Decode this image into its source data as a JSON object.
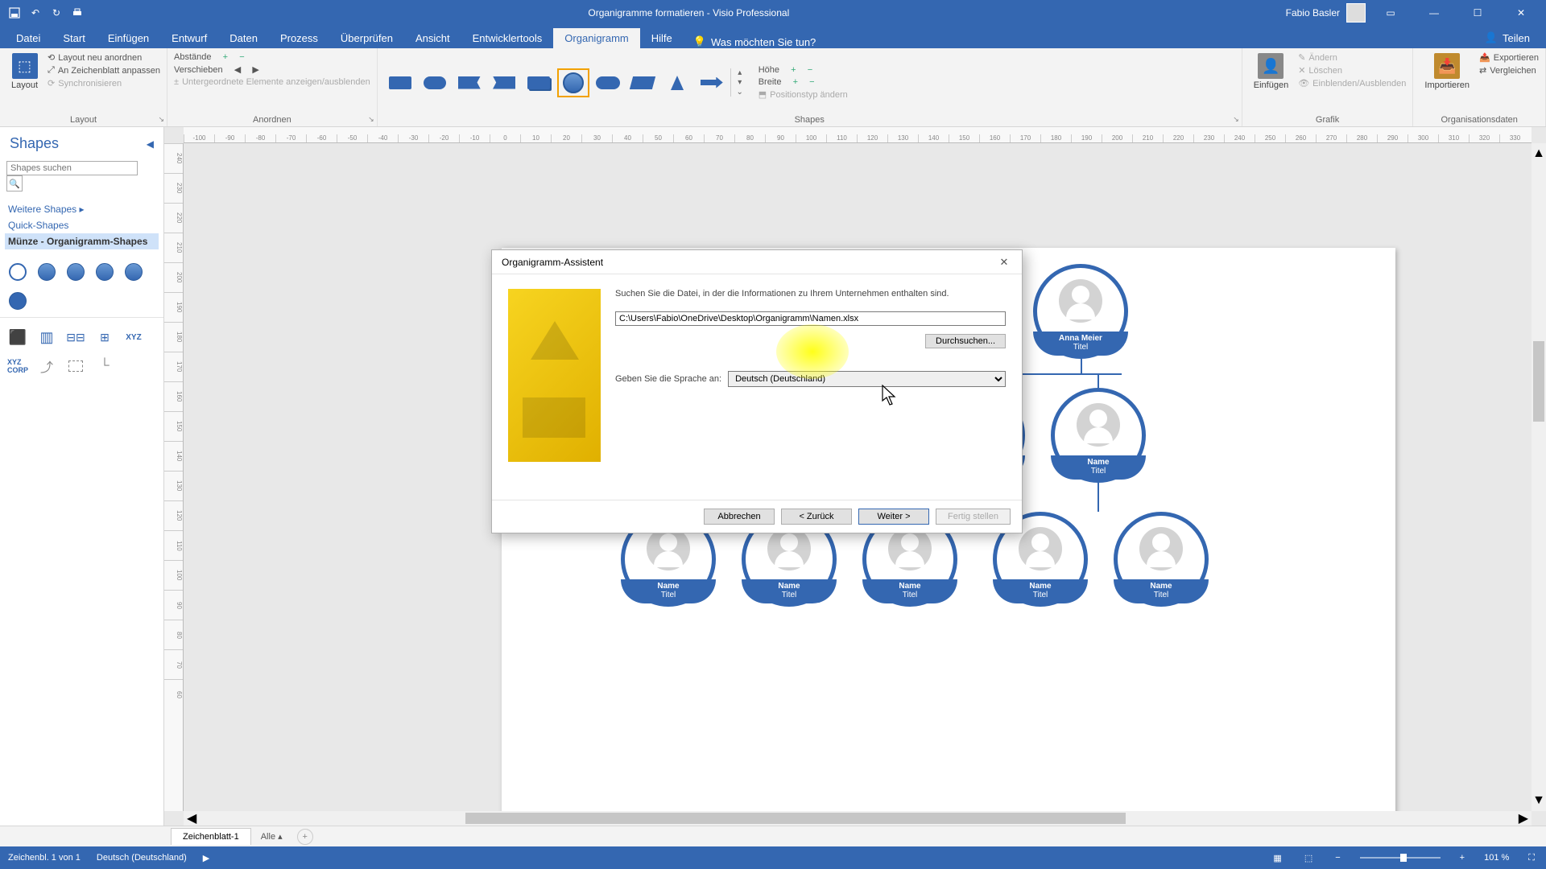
{
  "app": {
    "title": "Organigramme formatieren  -  Visio Professional",
    "user": "Fabio Basler"
  },
  "titlebar": {
    "share": "Teilen"
  },
  "tabs": {
    "file": "Datei",
    "start": "Start",
    "einfuegen": "Einfügen",
    "entwurf": "Entwurf",
    "daten": "Daten",
    "prozess": "Prozess",
    "ueberpruefen": "Überprüfen",
    "ansicht": "Ansicht",
    "entwicklertools": "Entwicklertools",
    "organigramm": "Organigramm",
    "hilfe": "Hilfe",
    "tellme": "Was möchten Sie tun?"
  },
  "ribbon": {
    "layout": {
      "button": "Layout",
      "realign": "Layout neu anordnen",
      "fit": "An Zeichenblatt anpassen",
      "sync": "Synchronisieren",
      "group": "Layout"
    },
    "anordnen": {
      "abstaende": "Abstände",
      "verschieben": "Verschieben",
      "sub": "Untergeordnete Elemente anzeigen/ausblenden",
      "group": "Anordnen"
    },
    "shapes": {
      "group": "Shapes",
      "hoehe": "Höhe",
      "breite": "Breite",
      "posChange": "Positionstyp ändern"
    },
    "grafik": {
      "einfuegen": "Einfügen",
      "aendern": "Ändern",
      "loeschen": "Löschen",
      "einblenden": "Einblenden/Ausblenden",
      "group": "Grafik"
    },
    "orgdata": {
      "importieren": "Importieren",
      "exportieren": "Exportieren",
      "vergleichen": "Vergleichen",
      "group": "Organisationsdaten"
    }
  },
  "shapesPanel": {
    "title": "Shapes",
    "searchPlaceholder": "Shapes suchen",
    "moreShapes": "Weitere Shapes",
    "quickShapes": "Quick-Shapes",
    "selected": "Münze - Organigramm-Shapes"
  },
  "canvas": {
    "hRuler": [
      "-100",
      "-90",
      "-80",
      "-70",
      "-60",
      "-50",
      "-40",
      "-30",
      "-20",
      "-10",
      "0",
      "10",
      "20",
      "30",
      "40",
      "50",
      "60",
      "70",
      "80",
      "90",
      "100",
      "110",
      "120",
      "130",
      "140",
      "150",
      "160",
      "170",
      "180",
      "190",
      "200",
      "210",
      "220",
      "230",
      "240",
      "250",
      "260",
      "270",
      "280",
      "290",
      "300",
      "310",
      "320",
      "330"
    ],
    "vRuler": [
      "240",
      "230",
      "220",
      "210",
      "200",
      "190",
      "180",
      "170",
      "160",
      "150",
      "140",
      "130",
      "120",
      "110",
      "100",
      "90",
      "80",
      "70",
      "60"
    ]
  },
  "org": {
    "root": {
      "name": "Anna Meier",
      "title": "Titel"
    },
    "generic": {
      "name": "Name",
      "title": "Titel"
    }
  },
  "dialog": {
    "title": "Organigramm-Assistent",
    "instruction": "Suchen Sie die Datei, in der die Informationen zu Ihrem Unternehmen enthalten sind.",
    "filepath": "C:\\Users\\Fabio\\OneDrive\\Desktop\\Organigramm\\Namen.xlsx",
    "browse": "Durchsuchen...",
    "langLabel": "Geben Sie die Sprache an:",
    "langValue": "Deutsch (Deutschland)",
    "cancel": "Abbrechen",
    "back": "< Zurück",
    "next": "Weiter >",
    "finish": "Fertig stellen"
  },
  "pagetabs": {
    "page1": "Zeichenblatt-1",
    "all": "Alle"
  },
  "status": {
    "page": "Zeichenbl. 1 von 1",
    "lang": "Deutsch (Deutschland)",
    "zoom": "101 %"
  }
}
